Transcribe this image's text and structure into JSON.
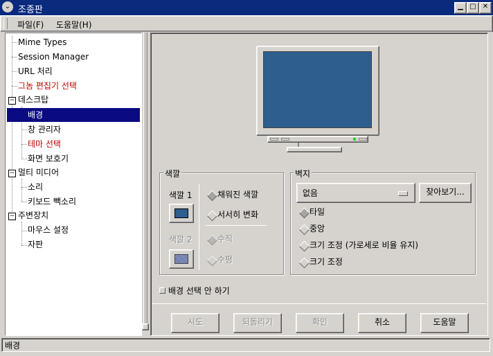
{
  "window": {
    "title": "조종판"
  },
  "menu": {
    "file": "파일(F)",
    "help": "도움말(H)"
  },
  "tree": {
    "items": [
      {
        "label": "Mime Types"
      },
      {
        "label": "Session Manager"
      },
      {
        "label": "URL 처리"
      },
      {
        "label": "그놈 편집기 선택"
      },
      {
        "label": "데스크탑"
      },
      {
        "label": "배경"
      },
      {
        "label": "창 관리자"
      },
      {
        "label": "테마 선택"
      },
      {
        "label": "화면 보호기"
      },
      {
        "label": "멀티 미디어"
      },
      {
        "label": "소리"
      },
      {
        "label": "키보드 빽소리"
      },
      {
        "label": "주변장치"
      },
      {
        "label": "마우스 설정"
      },
      {
        "label": "자판"
      }
    ],
    "expander_minus": "−"
  },
  "color_group": {
    "title": "색깔",
    "color1_label": "색깔 1",
    "color2_label": "색깔 2",
    "color1": "#2e5e8e",
    "solid_label": "채워진 색깔",
    "gradient_label": "서서히 변화",
    "vertical_label": "수직",
    "horizontal_label": "수평"
  },
  "wallpaper_group": {
    "title": "벽지",
    "selected": "없음",
    "browse": "찾아보기...",
    "tile": "타일",
    "center": "중앙",
    "scale_keep": "크기 조정 (가로세로 비율 유지)",
    "scale": "크기 조정"
  },
  "no_background": "배경 선택 안 하기",
  "buttons": {
    "try": "시도",
    "revert": "되돌리기",
    "ok": "확인",
    "cancel": "취소",
    "help": "도움말"
  },
  "statusbar": "배경",
  "monitor_screen_color": "#2e5e8e"
}
